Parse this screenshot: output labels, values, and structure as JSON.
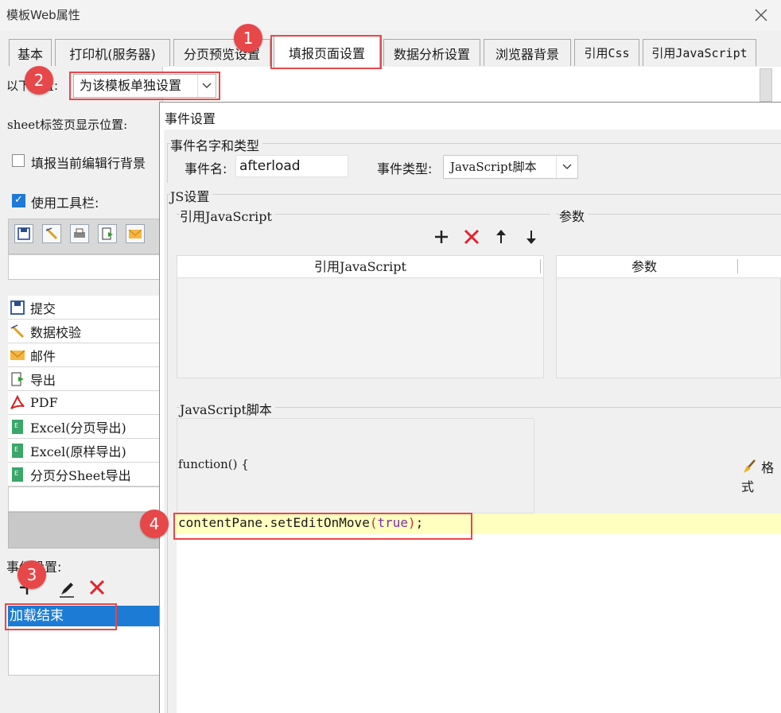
{
  "window": {
    "title": "模板Web属性"
  },
  "tabs": [
    {
      "label": "基本"
    },
    {
      "label": "打印机(服务器)"
    },
    {
      "label": "分页预览设置"
    },
    {
      "label": "填报页面设置",
      "active": true
    },
    {
      "label": "数据分析设置"
    },
    {
      "label": "浏览器背景"
    },
    {
      "label": "引用Css"
    },
    {
      "label": "引用JavaScript"
    }
  ],
  "left": {
    "scope_label": "以下设置:",
    "scope_value": "为该模板单独设置",
    "sheet_label": "sheet标签页显示位置:",
    "bg_checkbox_label": "填报当前编辑行背景",
    "toolbar_checkbox_label": "使用工具栏:",
    "toolbar_checkbox_checked": true,
    "toolbar_items": [
      {
        "label": "提交",
        "icon": "save-icon"
      },
      {
        "label": "数据校验",
        "icon": "check-pencil-icon"
      },
      {
        "label": "邮件",
        "icon": "mail-icon"
      },
      {
        "label": "导出",
        "icon": "export-icon"
      },
      {
        "label": "PDF",
        "icon": "pdf-icon"
      },
      {
        "label": "Excel(分页导出)",
        "icon": "excel-icon"
      },
      {
        "label": "Excel(原样导出)",
        "icon": "excel-icon"
      },
      {
        "label": "分页分Sheet导出",
        "icon": "excel-icon"
      }
    ],
    "event_label": "事件设置:",
    "event_items": [
      "加载结束"
    ]
  },
  "dialog": {
    "title": "事件设置",
    "name_type_group": "事件名字和类型",
    "event_name_label": "事件名:",
    "event_name_value": "afterload",
    "event_type_label": "事件类型:",
    "event_type_value": "JavaScript脚本",
    "js_group": "JS设置",
    "ref_js_label": "引用JavaScript",
    "params_label": "参数",
    "ref_js_column": "引用JavaScript",
    "params_column": "参数",
    "script_label": "JavaScript脚本",
    "function_header": "function() {",
    "format_button": "格式",
    "code_part1": "contentPane.setEditOnMove",
    "code_paren_open": "(",
    "code_arg": "true",
    "code_paren_close": ")",
    "code_end": ";"
  },
  "annotations": [
    "1",
    "2",
    "3",
    "4"
  ],
  "colors": {
    "annotation": "#e8474a",
    "selection": "#1c7bd4",
    "highlight": "#ffffc0",
    "keyword": "#7b2fa6",
    "paren": "#c0392b"
  }
}
